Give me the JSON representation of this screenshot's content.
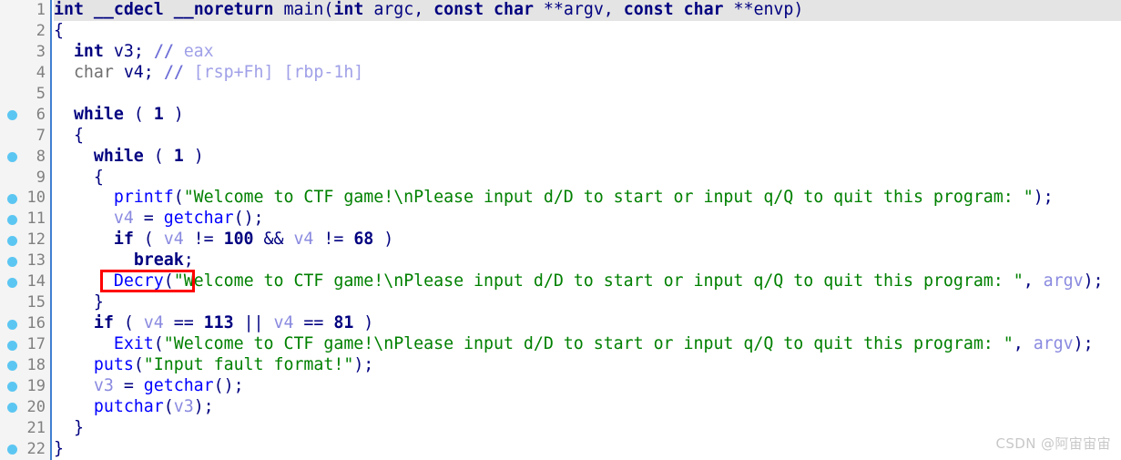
{
  "view": {
    "kind": "decompiler-pseudocode",
    "language": "C",
    "colors": {
      "background": "#ffffff",
      "gutter_background": "#f4f4f4",
      "gutter_separator": "#3f7fd0",
      "line_number": "#808080",
      "breakpoint_dot": "#5cc6f2",
      "current_line_highlight": "#e4e4e4",
      "keyword": "#000080",
      "function": "#0000ff",
      "string": "#008000",
      "variable": "#8a8ae0",
      "comment": "#a0a0e8",
      "annotation_box": "#ff0000"
    }
  },
  "annotation": {
    "shape": "rectangle",
    "color": "#ff0000",
    "covers_text": "Decry(\"W",
    "on_line": 14
  },
  "watermark": {
    "text": "CSDN @阿宙宙宙"
  },
  "lines": [
    {
      "n": 1,
      "bp": false,
      "text": "int __cdecl __noreturn main(int argc, const char **argv, const char **envp)"
    },
    {
      "n": 2,
      "bp": false,
      "text": "{"
    },
    {
      "n": 3,
      "bp": false,
      "text": "  int v3; // eax"
    },
    {
      "n": 4,
      "bp": false,
      "text": "  char v4; // [rsp+Fh] [rbp-1h]"
    },
    {
      "n": 5,
      "bp": false,
      "text": ""
    },
    {
      "n": 6,
      "bp": true,
      "text": "  while ( 1 )"
    },
    {
      "n": 7,
      "bp": false,
      "text": "  {"
    },
    {
      "n": 8,
      "bp": true,
      "text": "    while ( 1 )"
    },
    {
      "n": 9,
      "bp": false,
      "text": "    {"
    },
    {
      "n": 10,
      "bp": true,
      "text": "      printf(\"Welcome to CTF game!\\nPlease input d/D to start or input q/Q to quit this program: \");"
    },
    {
      "n": 11,
      "bp": true,
      "text": "      v4 = getchar();"
    },
    {
      "n": 12,
      "bp": true,
      "text": "      if ( v4 != 100 && v4 != 68 )"
    },
    {
      "n": 13,
      "bp": true,
      "text": "        break;"
    },
    {
      "n": 14,
      "bp": true,
      "text": "      Decry(\"Welcome to CTF game!\\nPlease input d/D to start or input q/Q to quit this program: \", argv);"
    },
    {
      "n": 15,
      "bp": false,
      "text": "    }"
    },
    {
      "n": 16,
      "bp": true,
      "text": "    if ( v4 == 113 || v4 == 81 )"
    },
    {
      "n": 17,
      "bp": true,
      "text": "      Exit(\"Welcome to CTF game!\\nPlease input d/D to start or input q/Q to quit this program: \", argv);"
    },
    {
      "n": 18,
      "bp": true,
      "text": "    puts(\"Input fault format!\");"
    },
    {
      "n": 19,
      "bp": true,
      "text": "    v3 = getchar();"
    },
    {
      "n": 20,
      "bp": true,
      "text": "    putchar(v3);"
    },
    {
      "n": 21,
      "bp": false,
      "text": "  }"
    },
    {
      "n": 22,
      "bp": true,
      "text": "}"
    }
  ],
  "tokens": {
    "l1": [
      {
        "t": "int",
        "c": "kw"
      },
      {
        "t": " ",
        "c": "pun"
      },
      {
        "t": "__cdecl",
        "c": "kw"
      },
      {
        "t": " ",
        "c": "pun"
      },
      {
        "t": "__noreturn",
        "c": "kw"
      },
      {
        "t": " ",
        "c": "pun"
      },
      {
        "t": "main",
        "c": "plain"
      },
      {
        "t": "(",
        "c": "pun"
      },
      {
        "t": "int",
        "c": "kw"
      },
      {
        "t": " ",
        "c": "pun"
      },
      {
        "t": "argc",
        "c": "plain"
      },
      {
        "t": ", ",
        "c": "pun"
      },
      {
        "t": "const",
        "c": "kw"
      },
      {
        "t": " ",
        "c": "pun"
      },
      {
        "t": "char",
        "c": "kw"
      },
      {
        "t": " **",
        "c": "pun"
      },
      {
        "t": "argv",
        "c": "plain"
      },
      {
        "t": ", ",
        "c": "pun"
      },
      {
        "t": "const",
        "c": "kw"
      },
      {
        "t": " ",
        "c": "pun"
      },
      {
        "t": "char",
        "c": "kw"
      },
      {
        "t": " **",
        "c": "pun"
      },
      {
        "t": "envp",
        "c": "plain"
      },
      {
        "t": ")",
        "c": "pun"
      }
    ],
    "l2": [
      {
        "t": "{",
        "c": "pun"
      }
    ],
    "l3": [
      {
        "t": "  ",
        "c": "pun"
      },
      {
        "t": "int",
        "c": "kw"
      },
      {
        "t": " v3; ",
        "c": "pun"
      },
      {
        "t": "//",
        "c": "cmtm"
      },
      {
        "t": " eax",
        "c": "cmt"
      }
    ],
    "l4": [
      {
        "t": "  ",
        "c": "pun"
      },
      {
        "t": "char",
        "c": "typ"
      },
      {
        "t": " v4; ",
        "c": "pun"
      },
      {
        "t": "//",
        "c": "cmtm"
      },
      {
        "t": " [rsp+Fh] [rbp-1h]",
        "c": "cmt"
      }
    ],
    "l5": [
      {
        "t": "",
        "c": "pun"
      }
    ],
    "l6": [
      {
        "t": "  ",
        "c": "pun"
      },
      {
        "t": "while",
        "c": "kw"
      },
      {
        "t": " ( ",
        "c": "pun"
      },
      {
        "t": "1",
        "c": "num"
      },
      {
        "t": " )",
        "c": "pun"
      }
    ],
    "l7": [
      {
        "t": "  {",
        "c": "pun"
      }
    ],
    "l8": [
      {
        "t": "    ",
        "c": "pun"
      },
      {
        "t": "while",
        "c": "kw"
      },
      {
        "t": " ( ",
        "c": "pun"
      },
      {
        "t": "1",
        "c": "num"
      },
      {
        "t": " )",
        "c": "pun"
      }
    ],
    "l9": [
      {
        "t": "    {",
        "c": "pun"
      }
    ],
    "l10": [
      {
        "t": "      ",
        "c": "pun"
      },
      {
        "t": "printf",
        "c": "fn"
      },
      {
        "t": "(",
        "c": "pun"
      },
      {
        "t": "\"Welcome to CTF game!\\nPlease input d/D to start or input q/Q to quit this program: \"",
        "c": "str"
      },
      {
        "t": ");",
        "c": "pun"
      }
    ],
    "l11": [
      {
        "t": "      ",
        "c": "pun"
      },
      {
        "t": "v4",
        "c": "var"
      },
      {
        "t": " = ",
        "c": "pun"
      },
      {
        "t": "getchar",
        "c": "fn"
      },
      {
        "t": "();",
        "c": "pun"
      }
    ],
    "l12": [
      {
        "t": "      ",
        "c": "pun"
      },
      {
        "t": "if",
        "c": "kw"
      },
      {
        "t": " ( ",
        "c": "pun"
      },
      {
        "t": "v4",
        "c": "var"
      },
      {
        "t": " != ",
        "c": "pun"
      },
      {
        "t": "100",
        "c": "num"
      },
      {
        "t": " && ",
        "c": "pun"
      },
      {
        "t": "v4",
        "c": "var"
      },
      {
        "t": " != ",
        "c": "pun"
      },
      {
        "t": "68",
        "c": "num"
      },
      {
        "t": " )",
        "c": "pun"
      }
    ],
    "l13": [
      {
        "t": "        ",
        "c": "pun"
      },
      {
        "t": "break",
        "c": "kw"
      },
      {
        "t": ";",
        "c": "pun"
      }
    ],
    "l14": [
      {
        "t": "      ",
        "c": "pun"
      },
      {
        "t": "Decry",
        "c": "fn"
      },
      {
        "t": "(",
        "c": "pun"
      },
      {
        "t": "\"Welcome to CTF game!\\nPlease input d/D to start or input q/Q to quit this program: \"",
        "c": "str"
      },
      {
        "t": ", ",
        "c": "pun"
      },
      {
        "t": "argv",
        "c": "var"
      },
      {
        "t": ");",
        "c": "pun"
      }
    ],
    "l15": [
      {
        "t": "    }",
        "c": "pun"
      }
    ],
    "l16": [
      {
        "t": "    ",
        "c": "pun"
      },
      {
        "t": "if",
        "c": "kw"
      },
      {
        "t": " ( ",
        "c": "pun"
      },
      {
        "t": "v4",
        "c": "var"
      },
      {
        "t": " == ",
        "c": "pun"
      },
      {
        "t": "113",
        "c": "num"
      },
      {
        "t": " || ",
        "c": "pun"
      },
      {
        "t": "v4",
        "c": "var"
      },
      {
        "t": " == ",
        "c": "pun"
      },
      {
        "t": "81",
        "c": "num"
      },
      {
        "t": " )",
        "c": "pun"
      }
    ],
    "l17": [
      {
        "t": "      ",
        "c": "pun"
      },
      {
        "t": "Exit",
        "c": "fn"
      },
      {
        "t": "(",
        "c": "pun"
      },
      {
        "t": "\"Welcome to CTF game!\\nPlease input d/D to start or input q/Q to quit this program: \"",
        "c": "str"
      },
      {
        "t": ", ",
        "c": "pun"
      },
      {
        "t": "argv",
        "c": "var"
      },
      {
        "t": ");",
        "c": "pun"
      }
    ],
    "l18": [
      {
        "t": "    ",
        "c": "pun"
      },
      {
        "t": "puts",
        "c": "fn"
      },
      {
        "t": "(",
        "c": "pun"
      },
      {
        "t": "\"Input fault format!\"",
        "c": "str"
      },
      {
        "t": ");",
        "c": "pun"
      }
    ],
    "l19": [
      {
        "t": "    ",
        "c": "pun"
      },
      {
        "t": "v3",
        "c": "var"
      },
      {
        "t": " = ",
        "c": "pun"
      },
      {
        "t": "getchar",
        "c": "fn"
      },
      {
        "t": "();",
        "c": "pun"
      }
    ],
    "l20": [
      {
        "t": "    ",
        "c": "pun"
      },
      {
        "t": "putchar",
        "c": "fn"
      },
      {
        "t": "(",
        "c": "pun"
      },
      {
        "t": "v3",
        "c": "var"
      },
      {
        "t": ");",
        "c": "pun"
      }
    ],
    "l21": [
      {
        "t": "  }",
        "c": "pun"
      }
    ],
    "l22": [
      {
        "t": "}",
        "c": "pun"
      }
    ]
  }
}
